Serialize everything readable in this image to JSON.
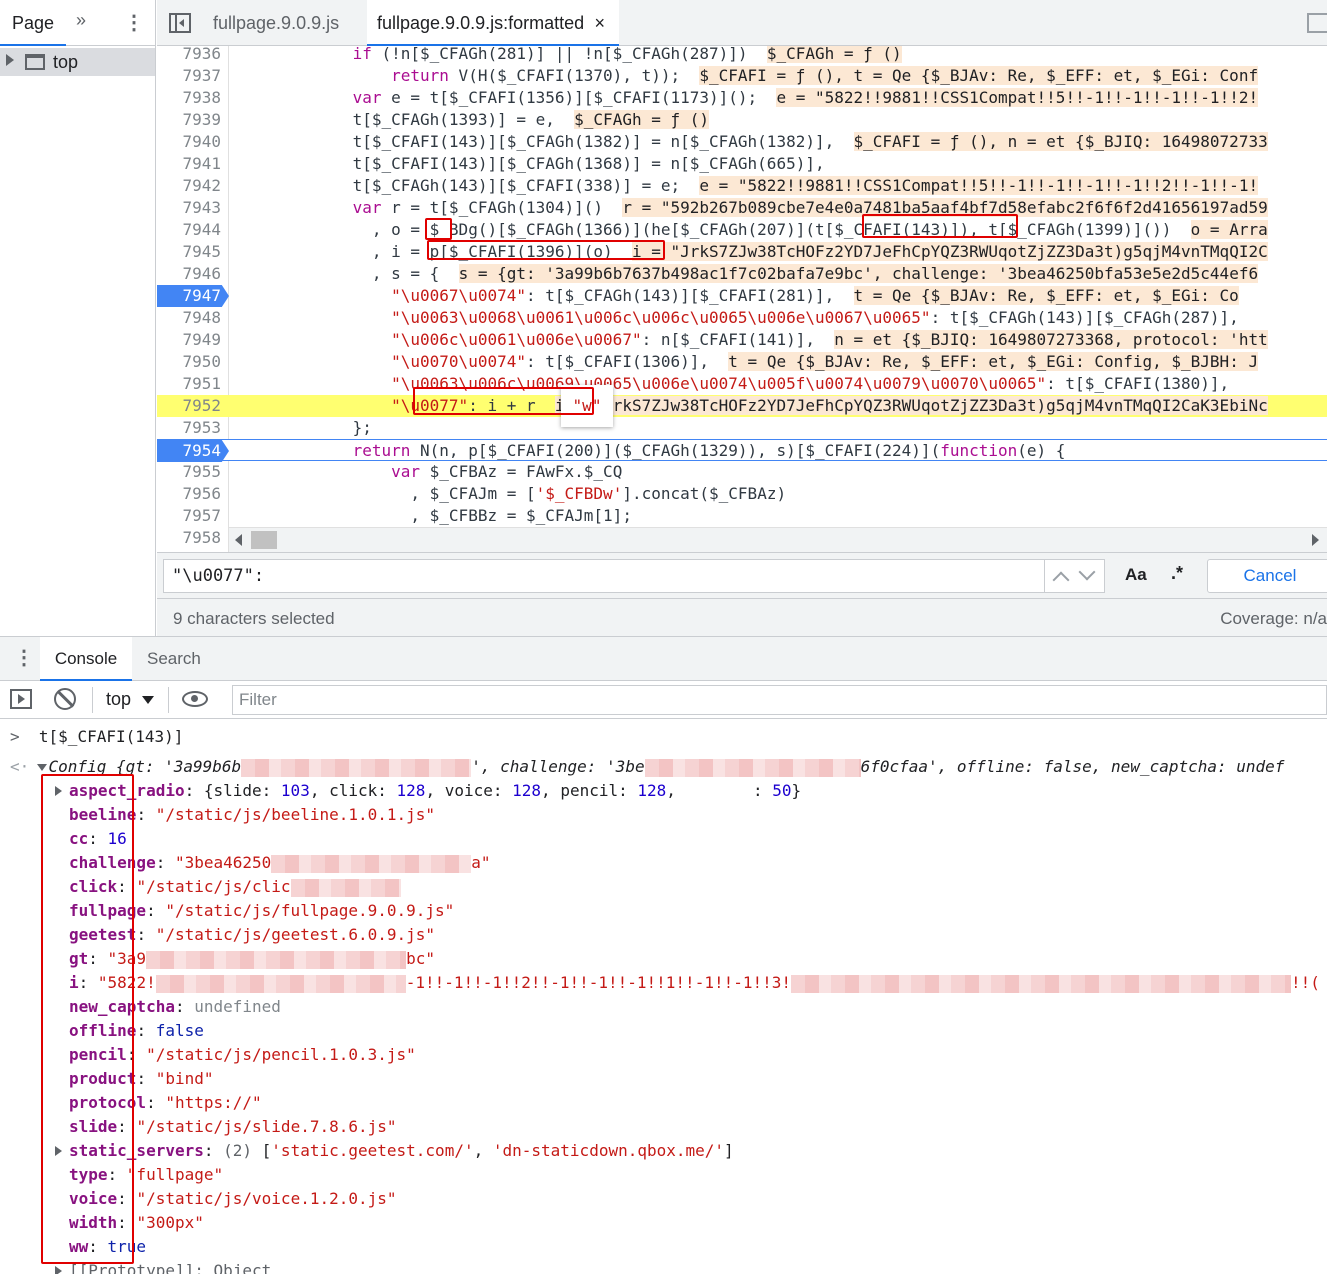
{
  "navigator": {
    "tab_page": "Page",
    "more": "»",
    "kebab": "⋮",
    "tree_top": "top"
  },
  "editor": {
    "tabs": [
      "fullpage.9.0.9.js",
      "fullpage.9.0.9.js:formatted"
    ],
    "close": "×",
    "lines": [
      {
        "n": "7936",
        "code": "            if (!n[$_CFAGh(281)] || !n[$_CFAGh(287)])  ",
        "inline": "$_CFAGh = ƒ ()"
      },
      {
        "n": "7937",
        "code": "                return V(H($_CFAFI(1370), t));  ",
        "inline": "$_CFAFI = ƒ (), t = Qe {$_BJAv: Re, $_EFF: et, $_EGi: Conf"
      },
      {
        "n": "7938",
        "code": "            var e = t[$_CFAFI(1356)][$_CFAFI(1173)]();  ",
        "inline": "e = \"5822!!9881!!CSS1Compat!!5!!-1!!-1!!-1!!-1!!2!"
      },
      {
        "n": "7939",
        "code": "            t[$_CFAGh(1393)] = e,  ",
        "inline": "$_CFAGh = ƒ ()"
      },
      {
        "n": "7940",
        "code": "            t[$_CFAFI(143)][$_CFAGh(1382)] = n[$_CFAGh(1382)],  ",
        "inline": "$_CFAFI = ƒ (), n = et {$_BJIQ: 16498072733"
      },
      {
        "n": "7941",
        "code": "            t[$_CFAFI(143)][$_CFAGh(1368)] = n[$_CFAGh(665)],",
        "inline": ""
      },
      {
        "n": "7942",
        "code": "            t[$_CFAGh(143)][$_CFAFI(338)] = e;  ",
        "inline": "e = \"5822!!9881!!CSS1Compat!!5!!-1!!-1!!-1!!-1!!2!!-1!!-1!"
      },
      {
        "n": "7943",
        "code": "            var r = t[$_CFAGh(1304)]()  ",
        "inline": "r = \"592b267b089cbe7e4e0a7481ba5aaf4bf7d58efabc2f6f6f2d41656197ad59"
      },
      {
        "n": "7944",
        "code": "              , o = $_BDg()[$_CFAGh(1366)](he[$_CFAGh(207)](t[$_CFAFI(143)]), t[$_CFAGh(1399)]())  ",
        "inline": "o = Arra"
      },
      {
        "n": "7945",
        "code": "              , i = p[$_CFAFI(1396)](o)  ",
        "inline": "i = \"JrkS7ZJw38TcHOFz2YD7JeFhCpYQZ3RWUqotZjZZ3Da3t)g5qjM4vnTMqQI2C"
      },
      {
        "n": "7946",
        "code": "              , s = {  ",
        "inline": "s = {gt: '3a99b6b7637b498ac1f7c02bafa7e9bc', challenge: '3bea46250bfa53e5e2d5c44ef6"
      },
      {
        "n": "7947",
        "code": "                \"\\u0067\\u0074\": t[$_CFAGh(143)][$_CFAFI(281)],  ",
        "inline": "t = Qe {$_BJAv: Re, $_EFF: et, $_EGi: Co"
      },
      {
        "n": "7948",
        "code": "                \"\\u0063\\u0068\\u0061\\u006c\\u006c\\u0065\\u006e\\u0067\\u0065\": t[$_CFAGh(143)][$_CFAGh(287)],",
        "inline": ""
      },
      {
        "n": "7949",
        "code": "                \"\\u006c\\u0061\\u006e\\u0067\": n[$_CFAFI(141)],  ",
        "inline": "n = et {$_BJIQ: 1649807273368, protocol: 'htt"
      },
      {
        "n": "7950",
        "code": "                \"\\u0070\\u0074\": t[$_CFAFI(1306)],  ",
        "inline": "t = Qe {$_BJAv: Re, $_EFF: et, $_EGi: Config, $_BJBH: J"
      },
      {
        "n": "7951",
        "code": "                \"\\u0063\\u006c\\u0069\\u0065\\u006e\\u0074\\u005f\\u0074\\u0079\\u0070\\u0065\": t[$_CFAFI(1380)],",
        "inline": ""
      },
      {
        "n": "7952",
        "code": "                \"\\u0077\": i + r  ",
        "inline": "i = \"JrkS7ZJw38TcHOFz2YD7JeFhCpYQZ3RWUqotZjZZ3Da3t)g5qjM4vnTMqQI2CaK3EbiNc"
      },
      {
        "n": "7953",
        "code": "            };",
        "inline": ""
      },
      {
        "n": "7954",
        "code": "            return N(n, p[$_CFAFI(200)]($_CFAGh(1329)), s)[$_CFAFI(224)](function(e) {",
        "inline": ""
      },
      {
        "n": "7955",
        "code": "                var $_CFBAz = FAwFx.$_CQ",
        "inline": ""
      },
      {
        "n": "7956",
        "code": "                  , $_CFAJm = ['$_CFBDw'].concat($_CFBAz)",
        "inline": ""
      },
      {
        "n": "7957",
        "code": "                  , $_CFBBz = $_CFAJm[1];",
        "inline": ""
      },
      {
        "n": "7958",
        "code": "",
        "inline": ""
      }
    ],
    "tooltip": "\"w\""
  },
  "find": {
    "query": "\"\\u0077\":",
    "case_label": "Aa",
    "regex_label": ".*",
    "cancel": "Cancel"
  },
  "status": {
    "selection": "9 characters selected",
    "coverage": "Coverage: n/a"
  },
  "drawer": {
    "kebab": "⋮",
    "tab_console": "Console",
    "tab_search": "Search",
    "context": "top",
    "filter_placeholder": "Filter"
  },
  "console": {
    "prompt": ">",
    "input": "t[$_CFAFI(143)]",
    "result_arrow": "<·",
    "config_head_a": "Config {gt: '3a99b6b",
    "config_head_b": "', challenge: '3be",
    "config_head_c": "6f0cfaa', offline: false, new_captcha: undef",
    "props": [
      {
        "k": "aspect_radio",
        "v": "{slide: 103, click: 128, voice: 128, pencil: 128,        : 50}",
        "t": "obj",
        "expand": true
      },
      {
        "k": "beeline",
        "v": "\"/static/js/beeline.1.0.1.js\"",
        "t": "str"
      },
      {
        "k": "cc",
        "v": "16",
        "t": "num"
      },
      {
        "k": "challenge",
        "v": "\"3bea46250",
        "t": "str",
        "blur": 200,
        "tail": "a\""
      },
      {
        "k": "click",
        "v": "\"/static/js/clic",
        "t": "str",
        "blur": 110,
        "tail": ""
      },
      {
        "k": "fullpage",
        "v": "\"/static/js/fullpage.9.0.9.js\"",
        "t": "str"
      },
      {
        "k": "geetest",
        "v": "\"/static/js/geetest.6.0.9.js\"",
        "t": "str"
      },
      {
        "k": "gt",
        "v": "\"3a9",
        "t": "str",
        "blur": 260,
        "tail": "bc\""
      },
      {
        "k": "i",
        "v": "\"5822!",
        "t": "str",
        "blur": 250,
        "tail": "-1!!-1!!-1!!2!!-1!!-1!!-1!!1!!-1!!-1!!3!",
        "blur2": 500,
        "tail2": "!!("
      },
      {
        "k": "new_captcha",
        "v": "undefined",
        "t": "undef"
      },
      {
        "k": "offline",
        "v": "false",
        "t": "kw"
      },
      {
        "k": "pencil",
        "v": "\"/static/js/pencil.1.0.3.js\"",
        "t": "str"
      },
      {
        "k": "product",
        "v": "\"bind\"",
        "t": "str"
      },
      {
        "k": "protocol",
        "v": "\"https://\"",
        "t": "str"
      },
      {
        "k": "slide",
        "v": "\"/static/js/slide.7.8.6.js\"",
        "t": "str"
      },
      {
        "k": "static_servers",
        "v": "(2) ['static.geetest.com/', 'dn-staticdown.qbox.me/']",
        "t": "arr",
        "expand": true
      },
      {
        "k": "type",
        "v": "\"fullpage\"",
        "t": "str"
      },
      {
        "k": "voice",
        "v": "\"/static/js/voice.1.2.0.js\"",
        "t": "str"
      },
      {
        "k": "width",
        "v": "\"300px\"",
        "t": "str"
      },
      {
        "k": "ww",
        "v": "true",
        "t": "kw"
      }
    ],
    "prototype_line": "[[Prototype]]: Object"
  },
  "colors": {
    "accent": "#1a73e8",
    "breakpoint": "#4285f4",
    "highlight": "#ffff70",
    "annotation_red": "#e00000"
  }
}
